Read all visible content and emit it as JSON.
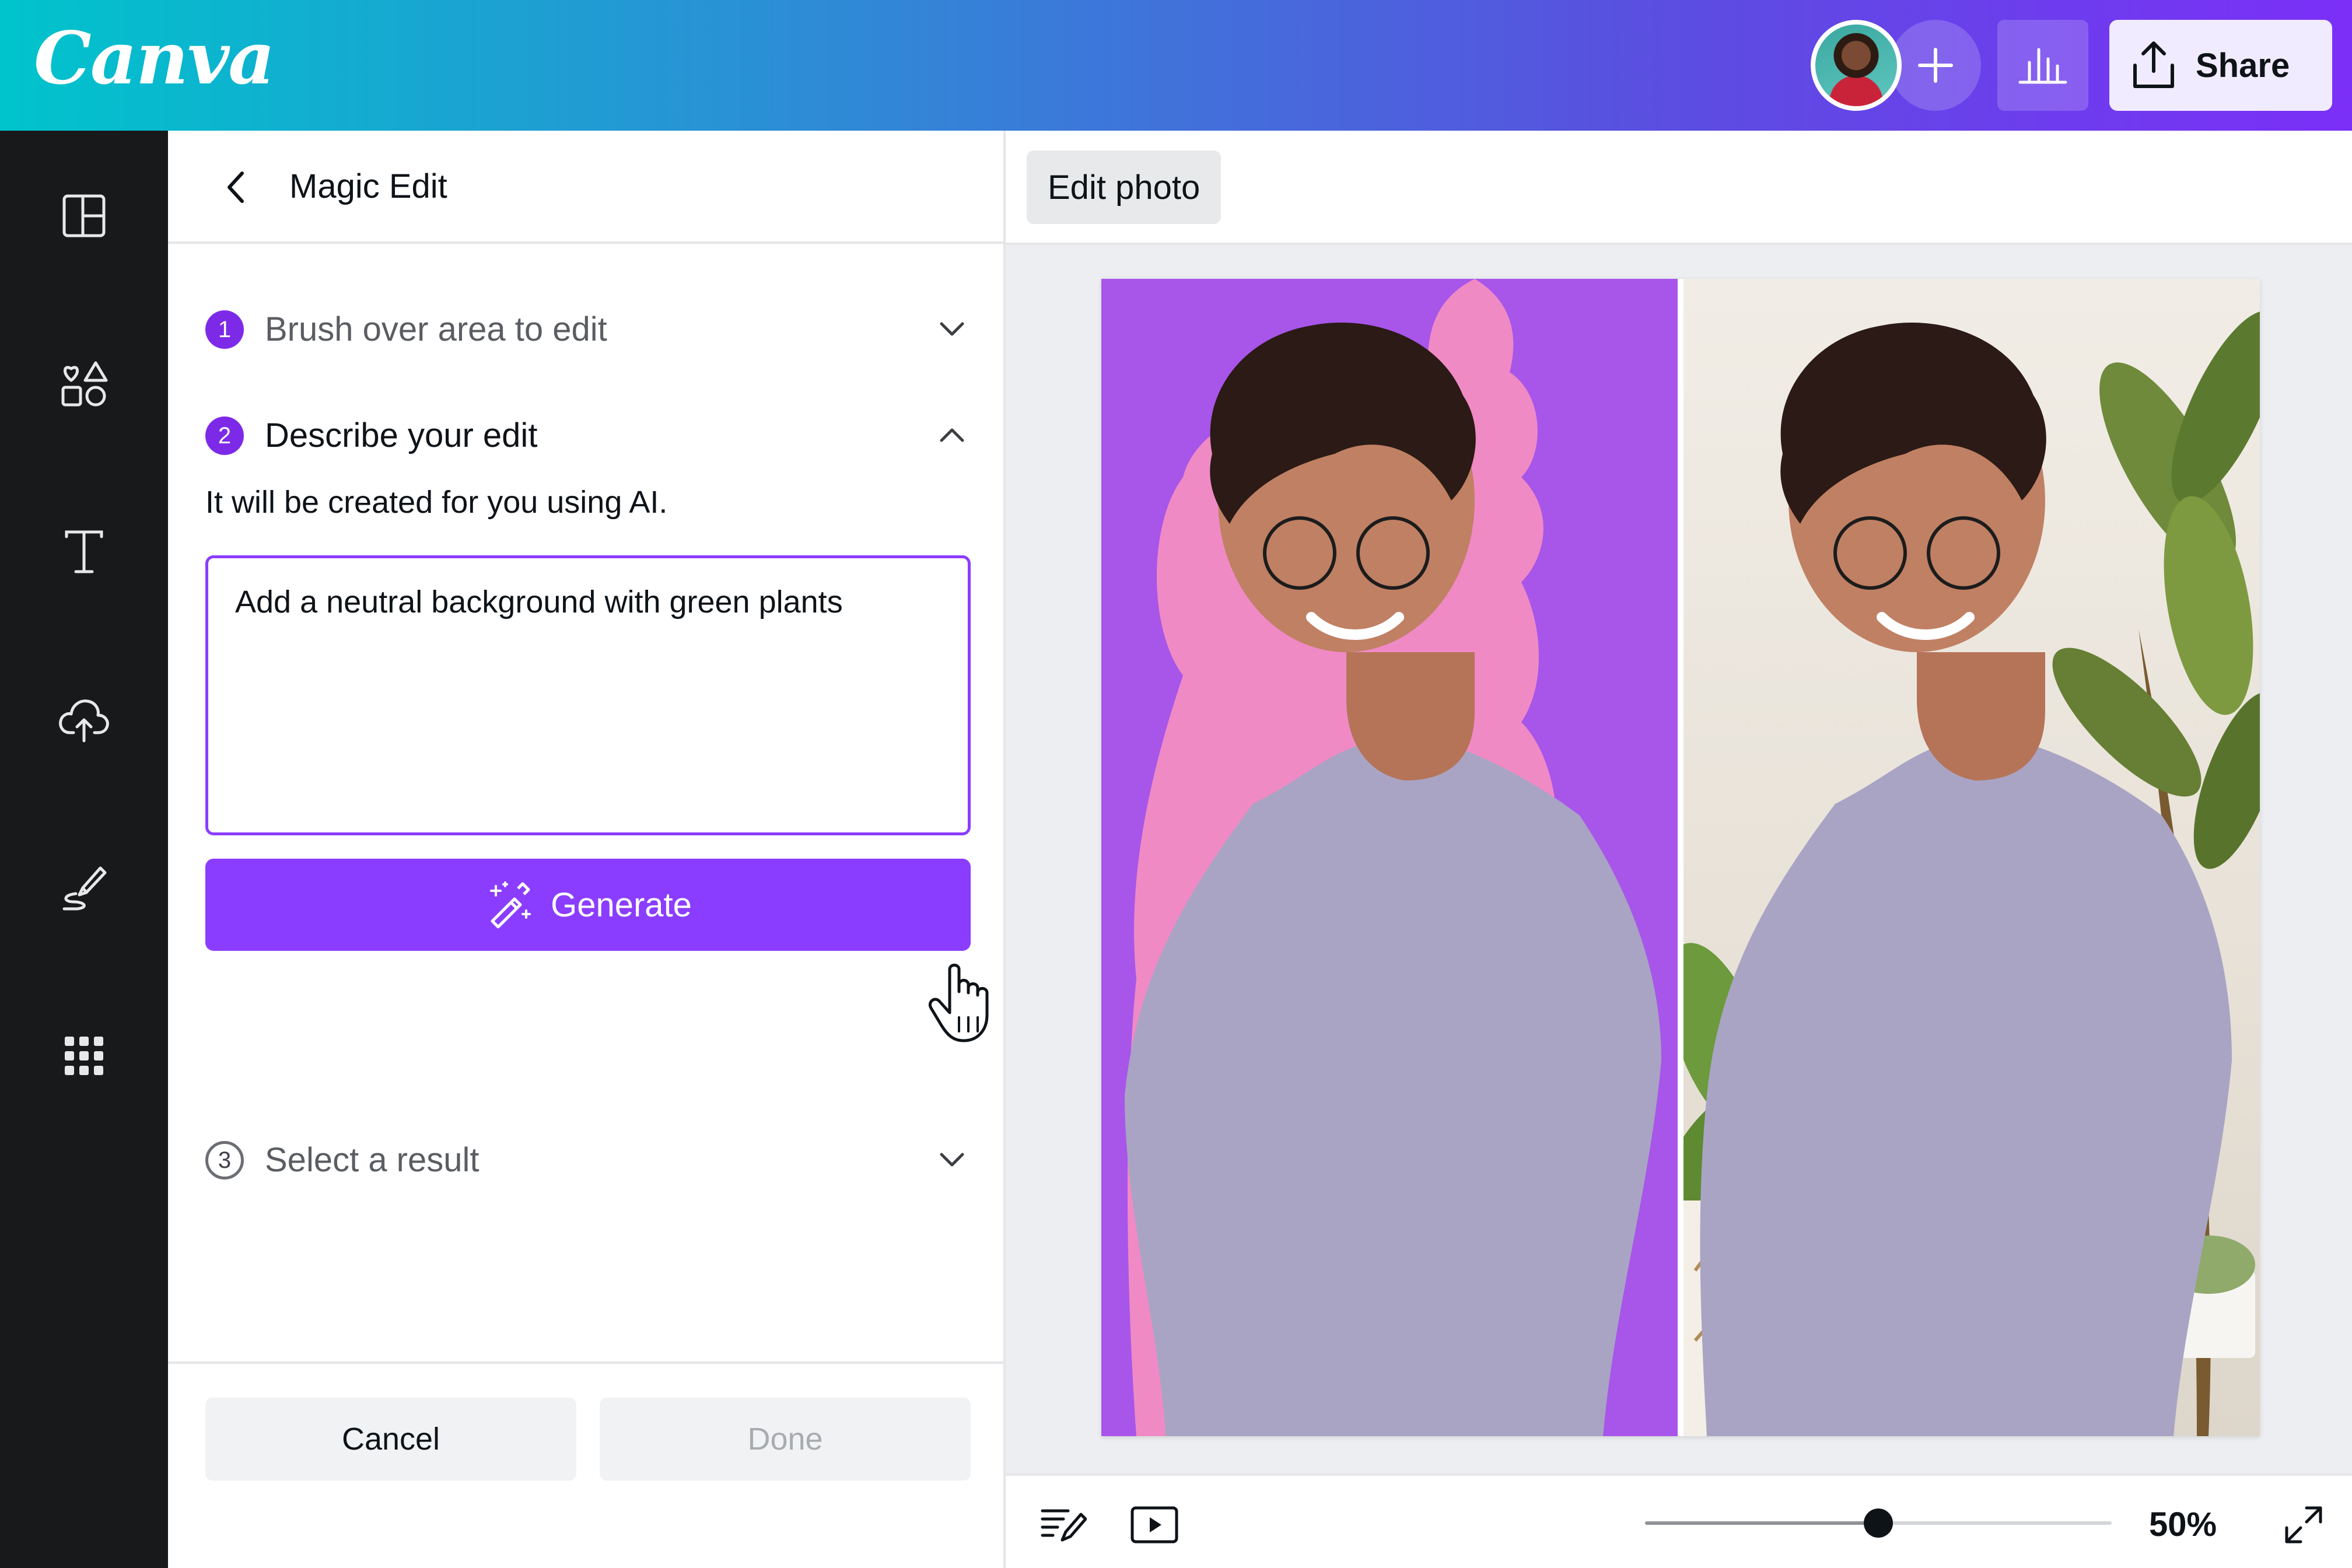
{
  "header": {
    "logo": "Canva",
    "share_label": "Share",
    "icons": [
      "avatar",
      "plus-icon",
      "insights-chart-icon",
      "share-upload-icon"
    ]
  },
  "rail": {
    "items": [
      "design-templates-icon",
      "elements-icon",
      "text-icon",
      "uploads-icon",
      "draw-icon",
      "apps-icon"
    ]
  },
  "panel": {
    "title": "Magic Edit",
    "steps": [
      {
        "number": "1",
        "title": "Brush over area to edit",
        "state": "collapsed"
      },
      {
        "number": "2",
        "title": "Describe your edit",
        "state": "expanded"
      },
      {
        "number": "3",
        "title": "Select a result",
        "state": "collapsed"
      }
    ],
    "hint": "It will be created for you using AI.",
    "prompt_value": "Add a neutral background with green plants",
    "generate_label": "Generate",
    "cancel_label": "Cancel",
    "done_label": "Done"
  },
  "canvas": {
    "edit_photo_label": "Edit photo",
    "zoom_label": "50%",
    "zoom_value": 0.5
  },
  "colors": {
    "accent": "#8b3dff",
    "rail_bg": "#18191b",
    "mask_pink": "#f08ac5",
    "left_bg": "#a855ea",
    "shirt": "#a9a4c4"
  }
}
